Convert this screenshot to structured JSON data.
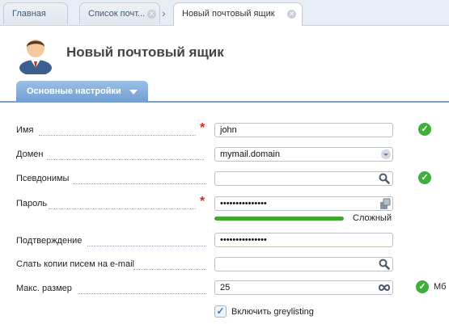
{
  "tabs": [
    {
      "label": "Главная"
    },
    {
      "label": "Список почт..."
    },
    {
      "label": "Новый почтовый ящик"
    }
  ],
  "page": {
    "title": "Новый почтовый ящик"
  },
  "section_tab": {
    "label": "Основные настройки"
  },
  "form": {
    "name": {
      "label": "Имя",
      "value": "john"
    },
    "domain": {
      "label": "Домен",
      "value": "mymail.domain"
    },
    "aliases": {
      "label": "Псевдонимы",
      "value": ""
    },
    "password": {
      "label": "Пароль",
      "value": "•••••••••••••••",
      "strength": "Сложный",
      "strength_level": 1.0
    },
    "confirm": {
      "label": "Подтверждение",
      "value": "•••••••••••••••"
    },
    "copy_email": {
      "label": "Слать копии писем на e-mail",
      "value": ""
    },
    "max_size": {
      "label": "Макс. размер",
      "value": "25",
      "unit": "Мб"
    },
    "greylisting": {
      "label": "Включить greylisting",
      "checked": true
    }
  },
  "colors": {
    "accent": "#7aa2cf",
    "ok": "#3fae3a",
    "required": "#d8261d"
  },
  "icons": {
    "ok": "check-circle-icon",
    "search": "search-icon",
    "generate": "key-generate-icon",
    "infinity": "infinity-icon",
    "dropdown": "chevron-down-icon"
  }
}
